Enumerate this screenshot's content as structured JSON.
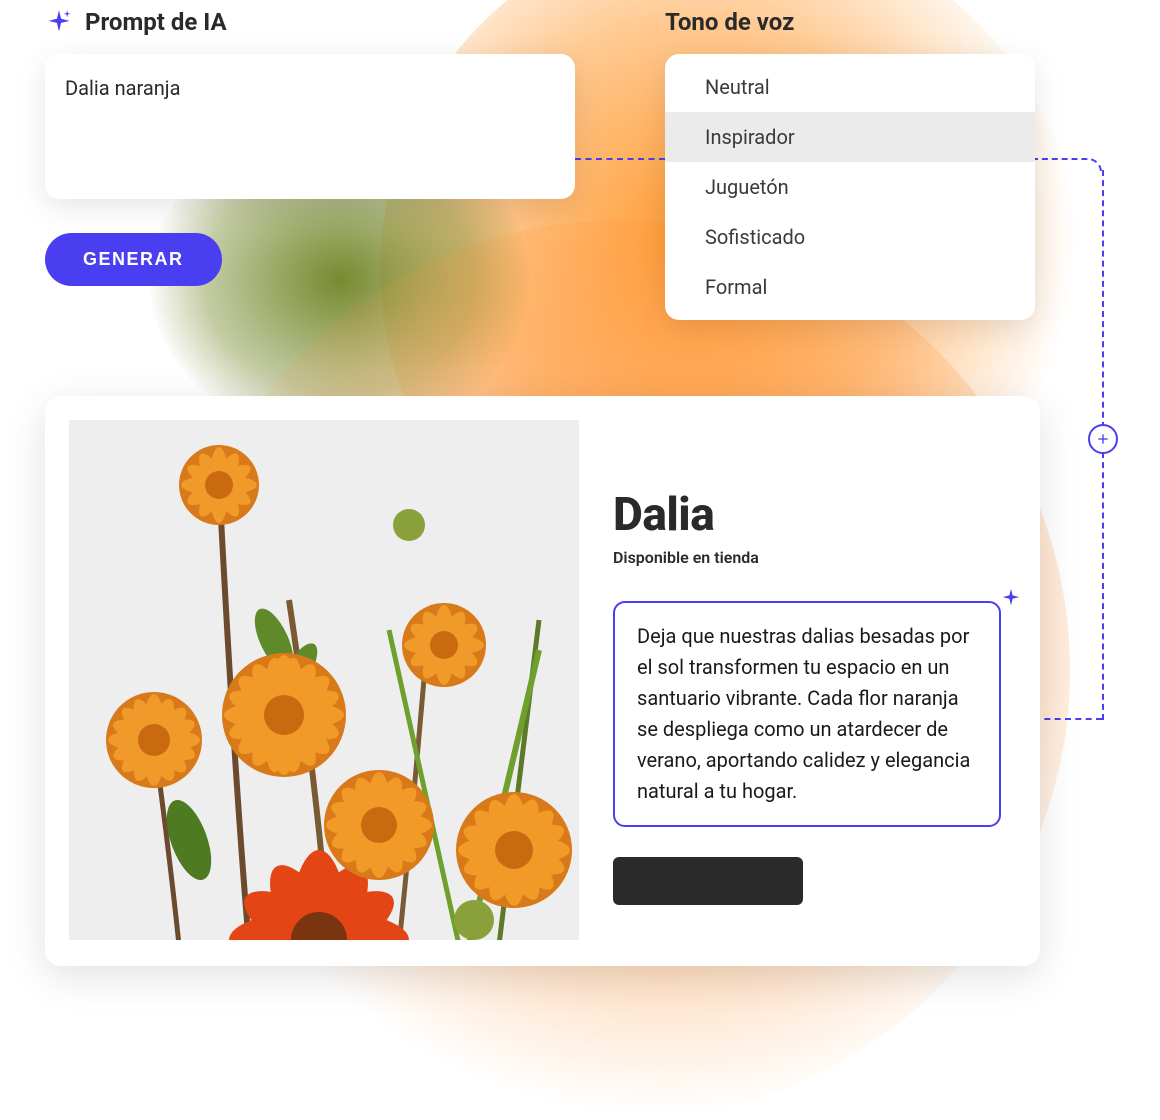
{
  "prompt": {
    "label": "Prompt de IA",
    "value": "Dalia naranja",
    "generate_label": "GENERAR"
  },
  "tone": {
    "label": "Tono de voz",
    "options": [
      "Neutral",
      "Inspirador",
      "Juguetón",
      "Sofisticado",
      "Formal"
    ],
    "selected_index": 1
  },
  "preview": {
    "product_title": "Dalia",
    "product_subtitle": "Disponible en tienda",
    "description": "Deja que nuestras dalias besadas por el sol transformen tu espacio en un santuario vibrante. Cada flor naranja se despliega como un atardecer de verano, aportando calidez y elegancia natural a tu hogar."
  },
  "colors": {
    "accent": "#4a3ff0"
  }
}
